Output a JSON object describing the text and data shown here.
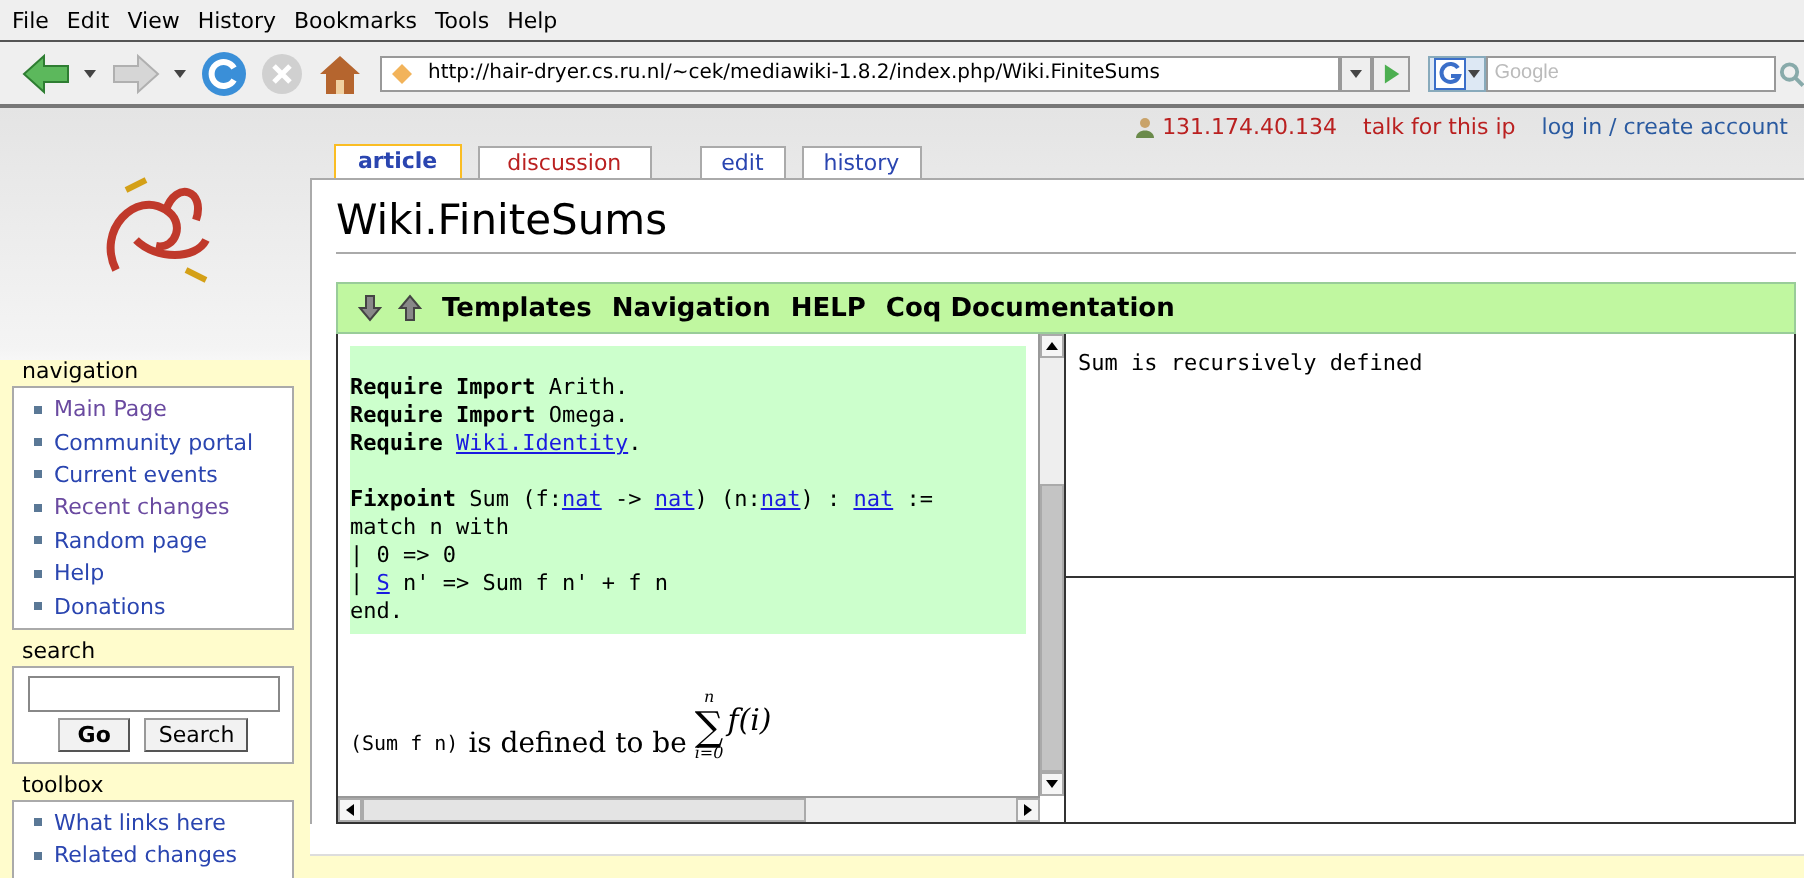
{
  "browser": {
    "menu": [
      {
        "label": "File"
      },
      {
        "label": "Edit"
      },
      {
        "label": "View"
      },
      {
        "label": "History"
      },
      {
        "label": "Bookmarks"
      },
      {
        "label": "Tools"
      },
      {
        "label": "Help"
      }
    ],
    "url": "http://hair-dryer.cs.ru.nl/~cek/mediawiki-1.8.2/index.php/Wiki.FiniteSums",
    "search_placeholder": "Google"
  },
  "user_links": [
    {
      "kind": "ip",
      "label": "131.174.40.134"
    },
    {
      "kind": "talk",
      "label": "talk for this ip"
    },
    {
      "kind": "login",
      "label": "log in / create account"
    }
  ],
  "tabs": [
    {
      "label": "article",
      "selected": true,
      "exists": true
    },
    {
      "label": "discussion",
      "selected": false,
      "exists": false
    },
    {
      "label": "edit",
      "selected": false,
      "exists": true
    },
    {
      "label": "history",
      "selected": false,
      "exists": true
    }
  ],
  "page_title": "Wiki.FiniteSums",
  "sidebar": {
    "navigation": {
      "title": "navigation",
      "items": [
        {
          "label": "Main Page",
          "visited": true
        },
        {
          "label": "Community portal",
          "visited": false
        },
        {
          "label": "Current events",
          "visited": false
        },
        {
          "label": "Recent changes",
          "visited": true
        },
        {
          "label": "Random page",
          "visited": false
        },
        {
          "label": "Help",
          "visited": false
        },
        {
          "label": "Donations",
          "visited": false
        }
      ]
    },
    "search": {
      "title": "search",
      "buttons": [
        "Go",
        "Search"
      ]
    },
    "toolbox": {
      "title": "toolbox",
      "items": [
        {
          "label": "What links here",
          "visited": false
        },
        {
          "label": "Related changes",
          "visited": false
        }
      ]
    }
  },
  "editor_toolbar": [
    "Templates",
    "Navigation",
    "HELP",
    "Coq Documentation"
  ],
  "script": [
    {
      "kind": "blank"
    },
    {
      "kind": "code",
      "segments": [
        {
          "kind": "kw",
          "text": "Require Import"
        },
        {
          "kind": "plain",
          "text": " Arith."
        }
      ]
    },
    {
      "kind": "code",
      "segments": [
        {
          "kind": "kw",
          "text": "Require Import"
        },
        {
          "kind": "plain",
          "text": " Omega."
        }
      ]
    },
    {
      "kind": "code",
      "segments": [
        {
          "kind": "kw",
          "text": "Require "
        },
        {
          "kind": "link",
          "text": "Wiki.Identity"
        },
        {
          "kind": "plain",
          "text": "."
        }
      ]
    },
    {
      "kind": "blank"
    },
    {
      "kind": "code",
      "segments": [
        {
          "kind": "kw",
          "text": "Fixpoint"
        },
        {
          "kind": "plain",
          "text": " Sum (f:"
        },
        {
          "kind": "link",
          "text": "nat"
        },
        {
          "kind": "plain",
          "text": " -> "
        },
        {
          "kind": "link",
          "text": "nat"
        },
        {
          "kind": "plain",
          "text": ") (n:"
        },
        {
          "kind": "link",
          "text": "nat"
        },
        {
          "kind": "plain",
          "text": ") : "
        },
        {
          "kind": "link",
          "text": "nat"
        },
        {
          "kind": "plain",
          "text": " :="
        }
      ]
    },
    {
      "kind": "code",
      "segments": [
        {
          "kind": "plain",
          "text": "match n with"
        }
      ]
    },
    {
      "kind": "code",
      "segments": [
        {
          "kind": "plain",
          "text": "| 0 => 0"
        }
      ]
    },
    {
      "kind": "code",
      "segments": [
        {
          "kind": "plain",
          "text": "| "
        },
        {
          "kind": "link",
          "text": "S"
        },
        {
          "kind": "plain",
          "text": " n' => Sum f n' + f n"
        }
      ]
    },
    {
      "kind": "code",
      "segments": [
        {
          "kind": "plain",
          "text": "end."
        }
      ]
    }
  ],
  "definition": {
    "code": "(Sum f n)",
    "text": "is defined to be",
    "sum_symbol": "∑",
    "sum_upper": "n",
    "sum_lower": "i=0",
    "sum_body": "f(i)"
  },
  "goal_text": "Sum is recursively defined"
}
